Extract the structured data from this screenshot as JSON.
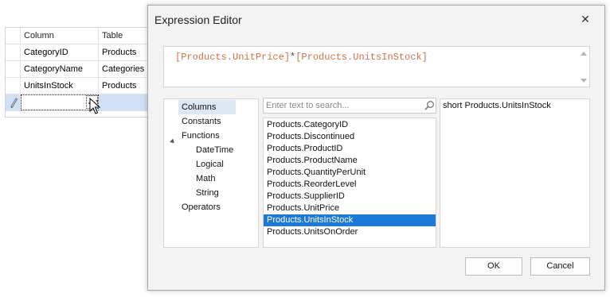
{
  "grid": {
    "headers": [
      "Column",
      "Table"
    ],
    "rows": [
      [
        "CategoryID",
        "Products"
      ],
      [
        "CategoryName",
        "Categories"
      ],
      [
        "UnitsInStock",
        "Products"
      ]
    ],
    "edit_row_ellipsis": "..."
  },
  "dialog": {
    "title": "Expression Editor",
    "close_label": "✕",
    "expression": {
      "part1": "[Products.UnitPrice]",
      "operator": "*",
      "part2": "[Products.UnitsInStock]"
    },
    "categories": [
      "Columns",
      "Constants",
      "Functions",
      "DateTime",
      "Logical",
      "Math",
      "String",
      "Operators"
    ],
    "selected_category": "Columns",
    "search_placeholder": "Enter text to search...",
    "items": [
      "Products.CategoryID",
      "Products.Discontinued",
      "Products.ProductID",
      "Products.ProductName",
      "Products.QuantityPerUnit",
      "Products.ReorderLevel",
      "Products.SupplierID",
      "Products.UnitPrice",
      "Products.UnitsInStock",
      "Products.UnitsOnOrder"
    ],
    "selected_item": "Products.UnitsInStock",
    "description": "short Products.UnitsInStock",
    "ok_label": "OK",
    "cancel_label": "Cancel"
  },
  "colors": {
    "selection": "#1c79d6",
    "expression_text": "#d0714a",
    "category_highlight": "#dde8f6"
  },
  "icons": [
    "pencil-icon",
    "dropdown-arrow-icon",
    "ellipsis-icon",
    "mouse-cursor-icon",
    "close-icon",
    "scroll-up-icon",
    "scroll-down-icon",
    "expand-arrow-icon",
    "search-icon"
  ]
}
